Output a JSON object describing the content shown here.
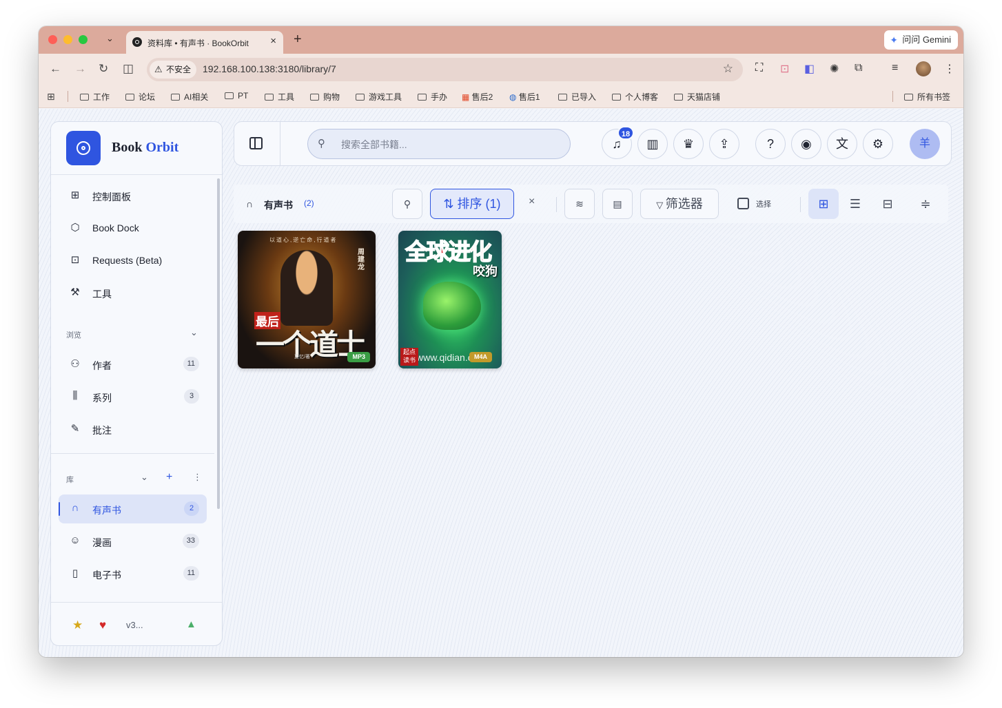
{
  "browser": {
    "tab_title": "资料库 • 有声书 · BookOrbit",
    "gemini_label": "问问 Gemini",
    "insecure_label": "不安全",
    "url": "192.168.100.138:3180/library/7",
    "bookmarks": [
      "工作",
      "论坛",
      "AI相关",
      "PT",
      "工具",
      "购物",
      "游戏工具",
      "手办",
      "售后2",
      "售后1",
      "已导入",
      "个人博客",
      "天猫店铺"
    ],
    "all_bookmarks": "所有书签"
  },
  "sidebar": {
    "brand_first": "Book",
    "brand_second": "Orbit",
    "main_items": [
      {
        "label": "控制面板",
        "icon": "dashboard-icon"
      },
      {
        "label": "Book Dock",
        "icon": "box-icon"
      },
      {
        "label": "Requests (Beta)",
        "icon": "request-icon"
      },
      {
        "label": "工具",
        "icon": "wrench-icon"
      }
    ],
    "browse_section": "浏览",
    "browse_items": [
      {
        "label": "作者",
        "count": "11"
      },
      {
        "label": "系列",
        "count": "3"
      },
      {
        "label": "批注",
        "count": ""
      }
    ],
    "library_section": "库",
    "library_items": [
      {
        "label": "有声书",
        "count": "2"
      },
      {
        "label": "漫画",
        "count": "33"
      },
      {
        "label": "电子书",
        "count": "11"
      }
    ],
    "version": "v3..."
  },
  "header": {
    "search_placeholder": "搜索全部书籍...",
    "notification_count": "18",
    "user_initial": "羊"
  },
  "library": {
    "title": "有声书",
    "count": "(2)",
    "sort_label": "排序 (1)",
    "filter_label": "筛选器",
    "select_label": "选择"
  },
  "books": [
    {
      "cover_title": "一个道士",
      "cover_prefix": "最后",
      "cover_author": "周建龙",
      "cover_top": "以道心,逆亡命,行道者",
      "cover_narrator": "夏忆/著",
      "format": "MP3"
    },
    {
      "cover_title": "全球进化",
      "cover_author": "咬狗",
      "cover_url": "www.qidian.com",
      "cover_stamp": "起点读书",
      "format": "M4A"
    }
  ],
  "colors": {
    "accent": "#2f55e0",
    "mp3_badge": "#3a9d45",
    "m4a_badge": "#c29a2a"
  }
}
